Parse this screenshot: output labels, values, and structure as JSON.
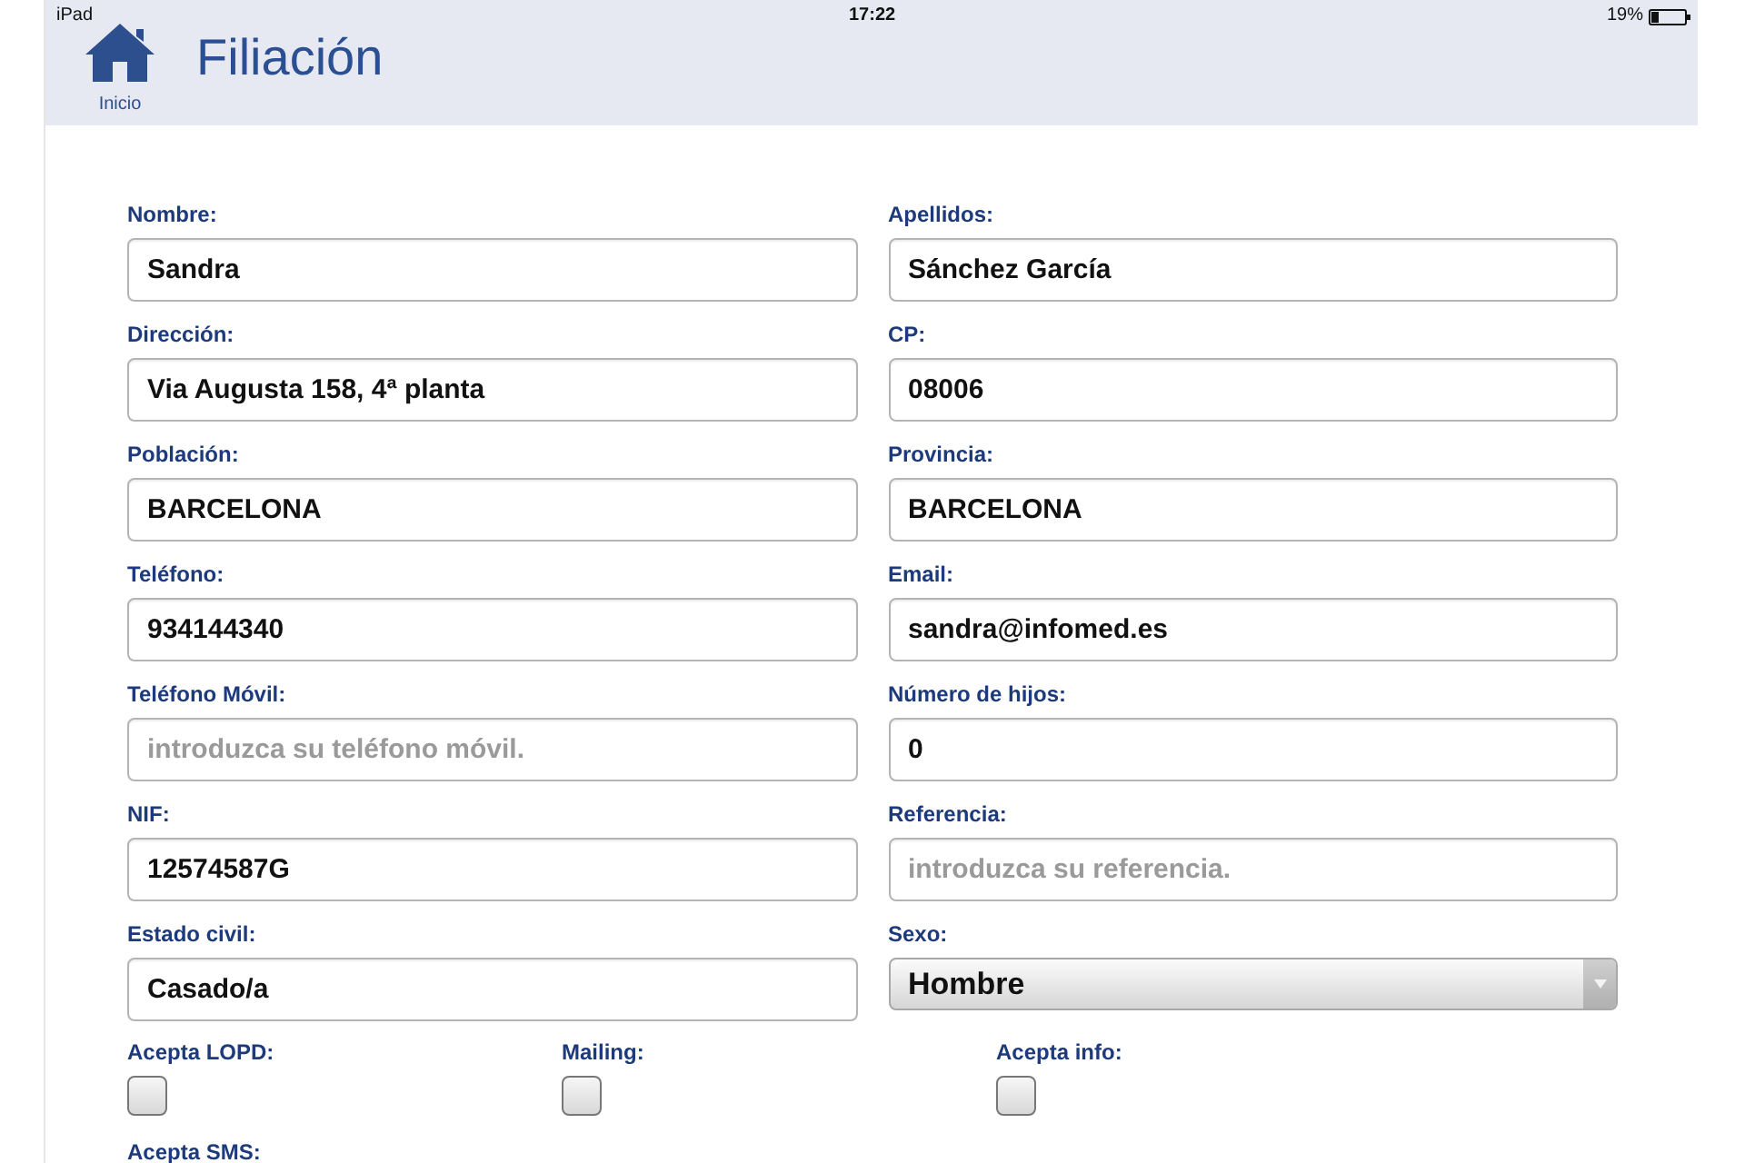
{
  "status_bar": {
    "device": "iPad",
    "time": "17:22",
    "battery": "19%"
  },
  "header": {
    "home_label": "Inicio",
    "title": "Filiación"
  },
  "form": {
    "fields": [
      {
        "label": "Nombre:",
        "kind": "text",
        "value": "Sandra"
      },
      {
        "label": "Apellidos:",
        "kind": "text",
        "value": "Sánchez García"
      },
      {
        "label": "Dirección:",
        "kind": "text",
        "value": "Via Augusta 158, 4ª planta"
      },
      {
        "label": "CP:",
        "kind": "text",
        "value": "08006"
      },
      {
        "label": "Población:",
        "kind": "text",
        "value": "BARCELONA"
      },
      {
        "label": "Provincia:",
        "kind": "text",
        "value": "BARCELONA"
      },
      {
        "label": "Teléfono:",
        "kind": "text",
        "value": "934144340"
      },
      {
        "label": "Email:",
        "kind": "text",
        "value": "sandra@infomed.es"
      },
      {
        "label": "Teléfono Móvil:",
        "kind": "text",
        "placeholder": "introduzca su teléfono móvil."
      },
      {
        "label": "Número de hijos:",
        "kind": "text",
        "value": "0"
      },
      {
        "label": "NIF:",
        "kind": "text",
        "value": "12574587G"
      },
      {
        "label": "Referencia:",
        "kind": "text",
        "placeholder": "introduzca su referencia."
      },
      {
        "label": "Estado civil:",
        "kind": "text",
        "value": "Casado/a"
      },
      {
        "label": "Sexo:",
        "kind": "select",
        "value": "Hombre"
      }
    ],
    "checkboxes": [
      {
        "label": "Acepta LOPD:",
        "checked": false
      },
      {
        "label": "Mailing:",
        "checked": false
      },
      {
        "label": "Acepta info:",
        "checked": false
      }
    ],
    "trailing_label": "Acepta SMS:"
  }
}
